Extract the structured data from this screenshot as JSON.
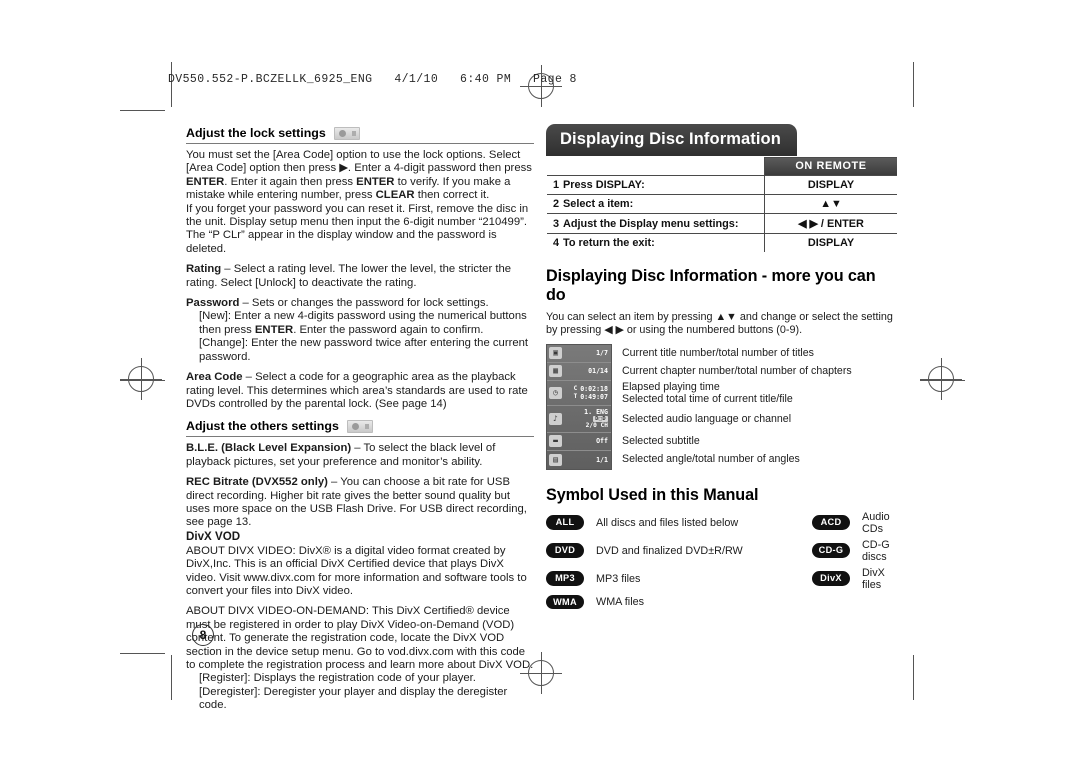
{
  "print_header": "DV550.552-P.BCZELLK_6925_ENG   4/1/10   6:40 PM   Page 8",
  "page_number": "8",
  "left_column": {
    "lock_section": {
      "heading": "Adjust the lock settings",
      "icon": "disc-chip-icon",
      "paragraphs": [
        "You must set the [Area Code] option to use the lock options. Select [Area Code] option then press ▶. Enter a 4-digit password then press ENTER. Enter it again then press ENTER to verify. If you make a mistake while entering number, press CLEAR then correct it.",
        "If you forget your password you can reset it. First, remove the disc in the unit. Display setup menu then input the 6-digit number “210499”. The “P CLr” appear in the display window and the password is deleted."
      ],
      "rating": "Rating – Select a rating level. The lower the level, the stricter the rating. Select [Unlock] to deactivate the rating.",
      "password": "Password – Sets or changes the password for lock settings.",
      "password_new": "[New]: Enter a new 4-digits password using the numerical buttons then press ENTER. Enter the password again to confirm.",
      "password_change": "[Change]: Enter the new password twice after entering the current password.",
      "area_code": "Area Code – Select a code for a geographic area as the playback rating level. This determines which area’s standards are used to rate DVDs controlled by the parental lock. (See page 14)"
    },
    "others_section": {
      "heading": "Adjust the others settings",
      "icon": "disc-chip-icon",
      "ble": "B.L.E. (Black Level Expansion) – To select the black level of playback pictures, set your preference and monitor’s ability.",
      "rec_bitrate": "REC Bitrate (DVX552 only) – You can choose a bit rate for USB direct recording. Higher bit rate gives the better sound quality but uses more space on the USB Flash Drive. For USB direct recording, see page 13.",
      "divx_vod_heading": "DivX VOD",
      "about_divx_video": "ABOUT DIVX VIDEO: DivX® is a digital video format created by DivX,Inc. This is an official DivX Certified device that plays DivX video. Visit www.divx.com for more information and software tools to convert your files into DivX video.",
      "about_divx_vod": "ABOUT DIVX VIDEO-ON-DEMAND: This DivX Certified® device must be registered in order to play DivX Video-on-Demand (VOD) content. To generate the registration code, locate the DivX VOD section in the device setup menu. Go to vod.divx.com with this code to complete the registration process and learn more about DivX VOD.",
      "register": "[Register]: Displays the registration code of your player.",
      "deregister": "[Deregister]: Deregister your player and display the deregister code."
    }
  },
  "right_column": {
    "banner_title": "Displaying Disc Information",
    "remote_header": "ON REMOTE",
    "steps": [
      {
        "num": "1",
        "action": "Press DISPLAY:",
        "remote": "DISPLAY"
      },
      {
        "num": "2",
        "action": "Select a item:",
        "remote": "▲▼"
      },
      {
        "num": "3",
        "action": "Adjust the Display menu settings:",
        "remote": "◀ ▶ / ENTER"
      },
      {
        "num": "4",
        "action": "To return the exit:",
        "remote": "DISPLAY"
      }
    ],
    "more_heading": "Displaying Disc Information - more you can do",
    "more_intro": "You can select an item by pressing ▲▼ and change or select the setting by pressing ◀ ▶ or using the numbered buttons (0-9).",
    "osd_rows": [
      {
        "icon": "title-icon",
        "value": "1/7",
        "desc": "Current title number/total number of titles"
      },
      {
        "icon": "chapter-icon",
        "value": "01/14",
        "desc": "Current chapter number/total number of chapters"
      },
      {
        "icon": "clock-icon",
        "value_c_label": "C",
        "value_c": "0:02:18",
        "value_t_label": "T",
        "value_t": "0:49:07",
        "desc_line1": "Elapsed playing time",
        "desc_line2": "Selected total time of current title/file"
      },
      {
        "icon": "headphone-icon",
        "value_line1": "1. ENG",
        "value_badge": "D□D",
        "value_line2": "2/0 CH",
        "desc": "Selected audio language or channel"
      },
      {
        "icon": "subtitle-icon",
        "value": "Off",
        "desc": "Selected subtitle"
      },
      {
        "icon": "angle-icon",
        "value": "1/1",
        "desc": "Selected angle/total number of angles"
      }
    ],
    "symbol_heading": "Symbol Used in this Manual",
    "symbols": [
      {
        "pill": "ALL",
        "label": "All discs and files listed below"
      },
      {
        "pill": "ACD",
        "label": "Audio CDs"
      },
      {
        "pill": "DVD",
        "label": "DVD and finalized DVD±R/RW"
      },
      {
        "pill": "CD-G",
        "label": "CD-G discs"
      },
      {
        "pill": "MP3",
        "label": "MP3 files"
      },
      {
        "pill": "DivX",
        "label": "DivX files"
      },
      {
        "pill": "WMA",
        "label": "WMA files"
      }
    ]
  }
}
